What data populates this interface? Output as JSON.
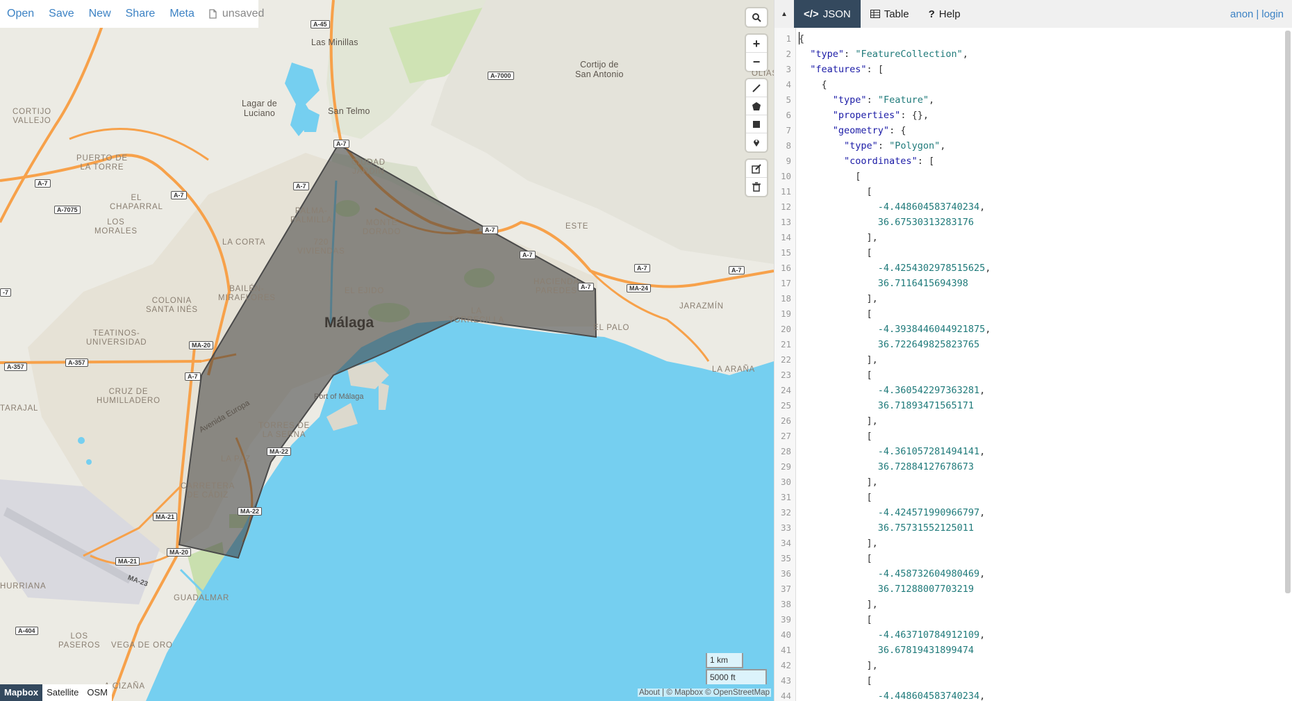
{
  "menu": {
    "open": "Open",
    "save": "Save",
    "new": "New",
    "share": "Share",
    "meta": "Meta",
    "status": "unsaved"
  },
  "map": {
    "labels": {
      "las_minillas": "Las Minillas",
      "cortijo": "Cortijo de\nSan Antonio",
      "lagar": "Lagar de\nLuciano",
      "san_telmo": "San Telmo",
      "cortijo_vallejo": "CORTIJO\nVALLEJO",
      "puerto_torre": "PUERTO DE\nLA TORRE",
      "ciudad_jardin": "CIUDAD\nJARDÍN",
      "el_chaparral": "EL\nCHAPARRAL",
      "los_morales": "LOS\nMORALES",
      "palma_palmilla": "PALMA-\nPALMILLA",
      "monte_dorado": "MONTE\nDORADO",
      "este": "ESTE",
      "la_corta": "LA CORTA",
      "viviendas": "720\nVIVIENDAS",
      "olias": "OLÍAS",
      "bailen": "BAILÉN-\nMIRAFLORES",
      "el_ejido": "EL EJIDO",
      "hacienda": "HACIENDA\nPAREDES",
      "colonia": "COLONIA\nSANTA INÉS",
      "jarazmin": "JARAZMÍN",
      "teatinos": "TEATINOS-\nUNIVERSIDAD",
      "malaga": "Málaga",
      "la_torrecilla": "LA\nTORRECILLA",
      "el_palo": "EL PALO",
      "la_arana": "LA ARAÑA",
      "cruz": "CRUZ DE\nHUMILLADERO",
      "tarajal": "TARAJAL",
      "port": "Port of Málaga",
      "torres": "TORRES DE\nLA SERNA",
      "avenida": "Avenida Europa",
      "la_paz": "LA PAZ",
      "carretera": "CARRETERA\nDE CÁDIZ",
      "hurriana": "HURRIANA",
      "guadalmar": "GUADALMAR",
      "los_paseros": "LOS\nPASEROS",
      "vega": "VEGA DE ORO",
      "la_cizana": "A CIZAÑA"
    },
    "shields": {
      "a45": "A-45",
      "a7000": "A-7000",
      "a7_top": "A-7",
      "a7_l1": "A-7",
      "a7_l2": "A-7",
      "a7_l3": "A-7",
      "a7075": "A-7075",
      "a7_mid": "A-7",
      "a7_e1": "A-7",
      "a7_e2": "A-7",
      "a7_e3": "A-7",
      "a7_e4": "A-7",
      "ma24": "MA-24",
      "a7_w": "-7",
      "ma20_a": "MA-20",
      "a357_a": "A-357",
      "a357_b": "A-357",
      "a7_c": "A-7",
      "ma22_a": "MA-22",
      "ma22_b": "MA-22",
      "ma21_a": "MA-21",
      "ma20_b": "MA-20",
      "ma21_b": "MA-21",
      "ma23": "MA-23",
      "a404": "A-404"
    },
    "scale_km": "1 km",
    "scale_ft": "5000 ft",
    "layers": [
      "Mapbox",
      "Satellite",
      "OSM"
    ],
    "active_layer": "Mapbox",
    "attribution": "About | © Mapbox © OpenStreetMap",
    "controls": [
      "search-icon",
      "zoom-in-icon",
      "zoom-out-icon",
      "draw-line-icon",
      "draw-polygon-icon",
      "draw-rectangle-icon",
      "draw-marker-icon",
      "edit-icon",
      "delete-icon"
    ],
    "colors": {
      "water": "#75cff0",
      "land": "#ecebe4",
      "park": "#cfe3b4",
      "road": "#f7a14a",
      "polygon": "#555555"
    }
  },
  "pane": {
    "tabs": [
      {
        "label": "JSON",
        "icon": "</>"
      },
      {
        "label": "Table",
        "icon": "table-icon"
      },
      {
        "label": "Help",
        "icon": "?"
      }
    ],
    "active_tab": "JSON",
    "user": {
      "anon": "anon",
      "sep": "|",
      "login": "login"
    },
    "line_numbers": [
      "1",
      "2",
      "3",
      "4",
      "5",
      "6",
      "7",
      "8",
      "9",
      "10",
      "11",
      "12",
      "13",
      "14",
      "15",
      "16",
      "17",
      "18",
      "19",
      "20",
      "21",
      "22",
      "23",
      "24",
      "25",
      "26",
      "27",
      "28",
      "29",
      "30",
      "31",
      "32",
      "33",
      "34",
      "35",
      "36",
      "37",
      "38",
      "39",
      "40",
      "41",
      "42",
      "43",
      "44"
    ],
    "code": [
      "{",
      "  \"type\": \"FeatureCollection\",",
      "  \"features\": [",
      "    {",
      "      \"type\": \"Feature\",",
      "      \"properties\": {},",
      "      \"geometry\": {",
      "        \"type\": \"Polygon\",",
      "        \"coordinates\": [",
      "          [",
      "            [",
      "              -4.448604583740234,",
      "              36.67530313283176",
      "            ],",
      "            [",
      "              -4.4254302978515625,",
      "              36.7116415694398",
      "            ],",
      "            [",
      "              -4.3938446044921875,",
      "              36.722649825823765",
      "            ],",
      "            [",
      "              -4.360542297363281,",
      "              36.71893471565171",
      "            ],",
      "            [",
      "              -4.361057281494141,",
      "              36.72884127678673",
      "            ],",
      "            [",
      "              -4.424571990966797,",
      "              36.75731552125011",
      "            ],",
      "            [",
      "              -4.458732604980469,",
      "              36.71288007703219",
      "            ],",
      "            [",
      "              -4.463710784912109,",
      "              36.67819431899474",
      "            ],",
      "            [",
      "              -4.448604583740234,"
    ]
  }
}
